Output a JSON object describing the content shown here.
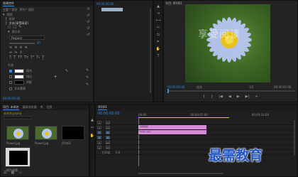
{
  "effect_controls": {
    "tab_label": "效果控件",
    "source_label": "主要 * 图形",
    "seq_label": "序列 * 图形",
    "section_video": "视频",
    "item_shape": "形状",
    "item_text": "文本(享受阅读)",
    "section_source_text": "源文本",
    "font_name": "Regular",
    "font_size": "95",
    "section_appearance": "外观",
    "fill_label": "填充",
    "stroke_label": "描边",
    "shadow_label": "阴影",
    "mask_label": "文本蒙版",
    "time_value": "00:00:00:00"
  },
  "source_mini": {
    "time": "00:00:00:00"
  },
  "program_monitor": {
    "title": "节目: 序列01",
    "watermark_text": "享受阅读",
    "timecode": "00:00:00:00",
    "fit_label": "适合",
    "fraction": "1/2",
    "end_time": "00:00:05:00",
    "controls": [
      "{",
      "}",
      "|◀",
      "◀",
      "▶",
      "▶|",
      "+"
    ]
  },
  "project": {
    "tabs": [
      "项目: 未命名",
      "媒体浏览器",
      "库",
      "信息"
    ],
    "path": "未命名.prproj",
    "items": [
      {
        "name": "flower.jpg",
        "dur": "5:00"
      },
      {
        "name": "flower.jpg",
        "dur": "5:00"
      },
      {
        "name": "序列01",
        "dur": "5:00"
      },
      {
        "name": "颜色遮罩",
        "dur": "5:00"
      }
    ]
  },
  "timeline": {
    "tab_label": "序列01",
    "timecode": "00:00:00:00",
    "ruler": [
      "00:00",
      "00:00:05:00",
      "00:00:10:00"
    ],
    "tracks": [
      "V3",
      "V2",
      "V1",
      "A1",
      "A2",
      "A3",
      "主声道"
    ],
    "clip_top_label": "享受阅读",
    "clip_bottom_label": "flower.jpg",
    "master_value": "0.0"
  },
  "brand_watermark": "最需教育",
  "colors": {
    "accent": "#2d8ceb",
    "clip": "#d68ad6",
    "bg": "#1d1d1d"
  }
}
